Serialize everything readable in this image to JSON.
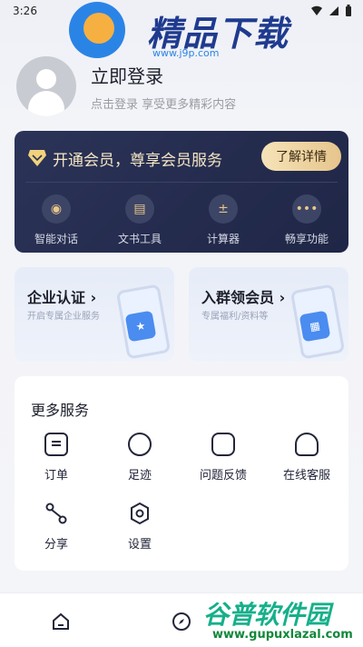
{
  "status_bar": {
    "time": "3:26"
  },
  "watermark_top": {
    "brand": "精品下载",
    "site": "www.j9p.com"
  },
  "profile": {
    "title": "立即登录",
    "subtitle": "点击登录 享受更多精彩内容"
  },
  "vip": {
    "headline": "开通会员，尊享会员服务",
    "button_label": "了解详情",
    "features": [
      {
        "label": "智能对话",
        "icon": "chat-icon"
      },
      {
        "label": "文书工具",
        "icon": "document-tool-icon"
      },
      {
        "label": "计算器",
        "icon": "calculator-icon"
      },
      {
        "label": "畅享功能",
        "icon": "more-dots-icon"
      }
    ]
  },
  "promos": [
    {
      "title": "企业认证 ›",
      "subtitle": "开启专属企业服务"
    },
    {
      "title": "入群领会员 ›",
      "subtitle": "专属福利/资料等"
    }
  ],
  "more_services": {
    "title": "更多服务",
    "items": [
      {
        "label": "订单",
        "icon": "order-icon"
      },
      {
        "label": "足迹",
        "icon": "footprint-icon"
      },
      {
        "label": "问题反馈",
        "icon": "feedback-icon"
      },
      {
        "label": "在线客服",
        "icon": "headset-icon"
      },
      {
        "label": "分享",
        "icon": "share-icon"
      },
      {
        "label": "设置",
        "icon": "settings-icon"
      }
    ]
  },
  "watermark_bottom": {
    "brand": "谷普软件园",
    "site": "www.gupuxlazal.com"
  },
  "colors": {
    "accent": "#2b3358",
    "gold": "#e6c58c"
  }
}
